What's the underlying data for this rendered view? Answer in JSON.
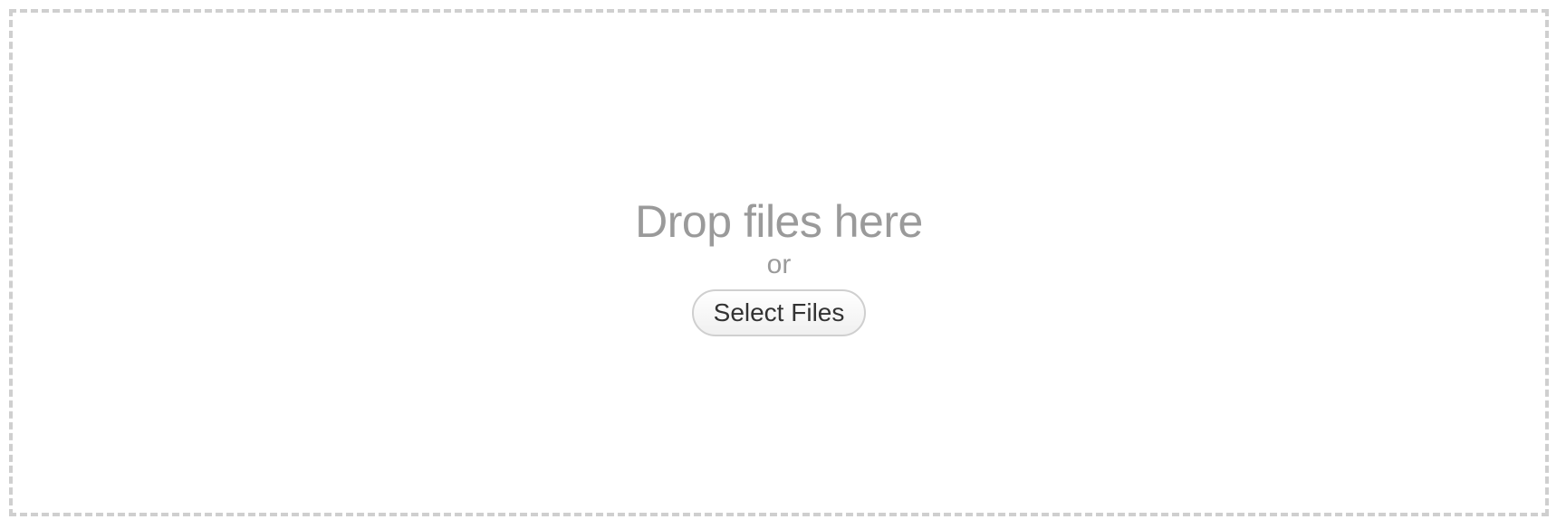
{
  "dropzone": {
    "title": "Drop files here",
    "or_text": "or",
    "select_button_label": "Select Files"
  },
  "colors": {
    "border": "#cfcfcf",
    "muted_text": "#9a9a9a",
    "button_text": "#333333"
  }
}
